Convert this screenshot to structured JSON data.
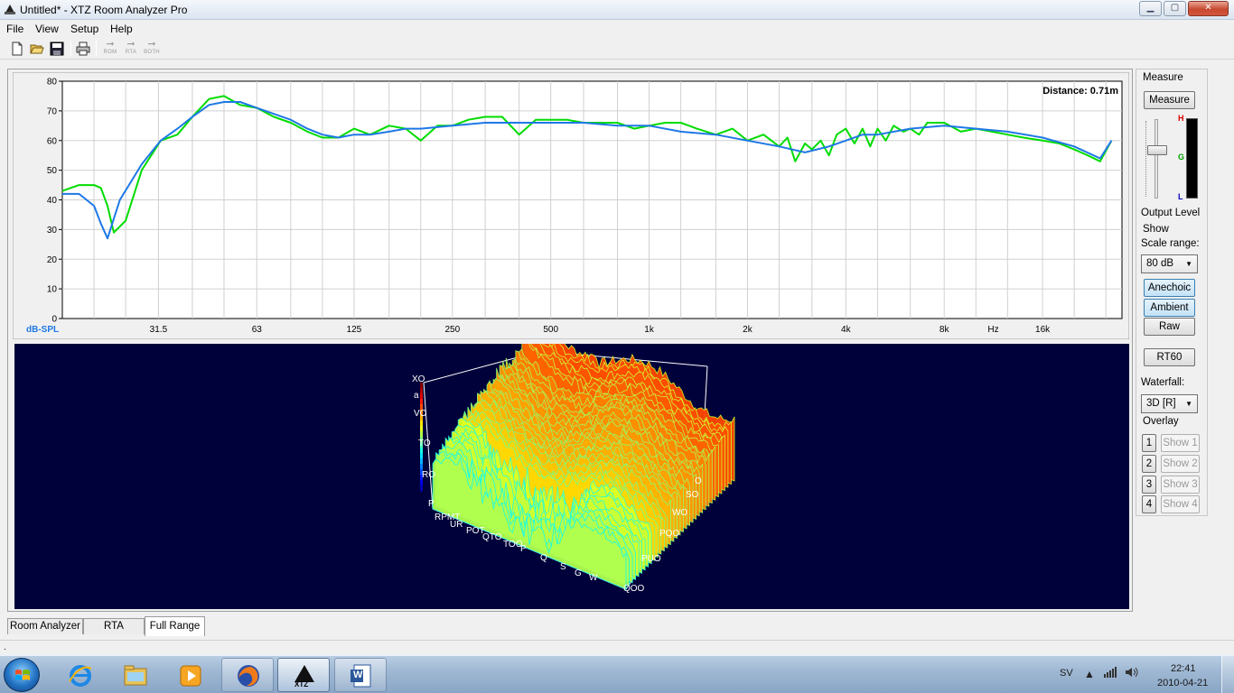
{
  "window": {
    "title": "Untitled* - XTZ Room Analyzer Pro",
    "minimize_glyph": "▁",
    "maximize_glyph": "▢",
    "close_glyph": "✕"
  },
  "menu": {
    "items": [
      "File",
      "View",
      "Setup",
      "Help"
    ]
  },
  "toolbar": {
    "icons": [
      "new-document-icon",
      "open-folder-icon",
      "save-disk-icon",
      "print-icon"
    ],
    "modes": [
      {
        "label": "ROM",
        "arrow": "➞"
      },
      {
        "label": "RTA",
        "arrow": "➞"
      },
      {
        "label": "BOTH",
        "arrow": "➞"
      }
    ]
  },
  "chart_data": [
    {
      "type": "line",
      "title": "",
      "annotation": "Distance: 0.71m",
      "ylabel": "dB-SPL",
      "xlabel": "Hz",
      "xscale": "log",
      "xlim": [
        16,
        28000
      ],
      "ylim": [
        0,
        80
      ],
      "y_ticks": [
        0,
        10,
        20,
        30,
        40,
        50,
        60,
        70,
        80
      ],
      "x_tick_labels": [
        "31.5",
        "63",
        "125",
        "250",
        "500",
        "1k",
        "2k",
        "4k",
        "8k",
        "Hz",
        "16k"
      ],
      "grid": true,
      "series": [
        {
          "color": "#00dc00",
          "x": [
            16,
            18,
            20,
            21,
            22,
            23,
            25,
            28,
            32,
            36,
            40,
            45,
            50,
            56,
            63,
            71,
            80,
            90,
            100,
            112,
            125,
            140,
            160,
            180,
            200,
            225,
            250,
            280,
            315,
            355,
            400,
            450,
            500,
            560,
            630,
            710,
            800,
            900,
            1000,
            1120,
            1250,
            1400,
            1600,
            1800,
            2000,
            2240,
            2500,
            2650,
            2800,
            3000,
            3150,
            3350,
            3550,
            3750,
            4000,
            4250,
            4500,
            4750,
            5000,
            5300,
            5600,
            6000,
            6300,
            6700,
            7100,
            8000,
            9000,
            10000,
            11200,
            12500,
            14000,
            16000,
            18000,
            20000,
            22000,
            24000,
            26000
          ],
          "y": [
            43,
            45,
            45,
            44,
            38,
            29,
            33,
            50,
            60,
            62,
            68,
            74,
            75,
            72,
            71,
            68,
            66,
            63,
            61,
            61,
            64,
            62,
            65,
            64,
            60,
            65,
            65,
            67,
            68,
            68,
            62,
            67,
            67,
            67,
            66,
            66,
            66,
            64,
            65,
            66,
            66,
            64,
            62,
            64,
            60,
            62,
            58,
            61,
            53,
            59,
            57,
            60,
            55,
            62,
            64,
            59,
            64,
            58,
            64,
            60,
            65,
            63,
            64,
            62,
            66,
            66,
            63,
            64,
            63,
            62,
            61,
            60,
            59,
            57,
            55,
            53,
            60
          ]
        },
        {
          "color": "#1e78e6",
          "x": [
            16,
            18,
            20,
            21,
            22,
            24,
            28,
            32,
            36,
            40,
            45,
            50,
            56,
            63,
            71,
            80,
            90,
            100,
            112,
            125,
            140,
            160,
            180,
            200,
            250,
            315,
            400,
            500,
            630,
            800,
            1000,
            1250,
            1600,
            2000,
            2500,
            3000,
            3550,
            4000,
            4500,
            5000,
            6300,
            8000,
            10000,
            12500,
            16000,
            20000,
            24000,
            26000
          ],
          "y": [
            42,
            42,
            38,
            32,
            27,
            40,
            52,
            60,
            64,
            68,
            72,
            73,
            73,
            71,
            69,
            67,
            64,
            62,
            61,
            62,
            62,
            63,
            64,
            64,
            65,
            66,
            66,
            66,
            66,
            65,
            65,
            63,
            62,
            60,
            58,
            56,
            58,
            60,
            62,
            62,
            64,
            65,
            64,
            63,
            61,
            58,
            54,
            60
          ]
        }
      ]
    },
    {
      "type": "area",
      "subtype": "3d-waterfall",
      "colormap": "jet",
      "vertical_axis_labels": [
        "XO",
        "a",
        "VO",
        "TO",
        "RO",
        "P"
      ],
      "frequency_axis_labels": [
        "RPMT",
        "UR",
        "POT",
        "QTO",
        "TOO",
        "P",
        "Q",
        "S",
        "G",
        "W"
      ],
      "time_axis_labels": [
        "O",
        "SO",
        "WO",
        "PQO",
        "PUO",
        "QOO"
      ]
    }
  ],
  "right_panel": {
    "measure_group": "Measure",
    "measure_button": "Measure",
    "meter_labels": {
      "high": "H",
      "good": "G",
      "low": "L"
    },
    "meter_colors": {
      "high": "#e00000",
      "good": "#00a000",
      "low": "#0000c0"
    },
    "output_level_label": "Output Level",
    "show_group": "Show",
    "scale_range_label": "Scale range:",
    "scale_range_value": "80 dB",
    "anechoic_button": "Anechoic",
    "ambient_button": "Ambient",
    "raw_button": "Raw",
    "rt60_button": "RT60",
    "waterfall_label": "Waterfall:",
    "waterfall_value": "3D [R]",
    "overlay_group": "Overlay",
    "overlays": [
      {
        "num": "1",
        "show": "Show 1"
      },
      {
        "num": "2",
        "show": "Show 2"
      },
      {
        "num": "3",
        "show": "Show 3"
      },
      {
        "num": "4",
        "show": "Show 4"
      }
    ]
  },
  "tabs": [
    "Room Analyzer",
    "RTA",
    "Full Range"
  ],
  "active_tab": "Full Range",
  "status_text": ".",
  "taskbar": {
    "apps": [
      "internet-explorer-icon",
      "windows-explorer-icon",
      "media-player-icon",
      "firefox-icon",
      "xtz-icon",
      "word-icon"
    ],
    "xtz_label": "XTZ",
    "word_label": "W",
    "lang": "SV",
    "time": "22:41",
    "date": "2010-04-21"
  }
}
